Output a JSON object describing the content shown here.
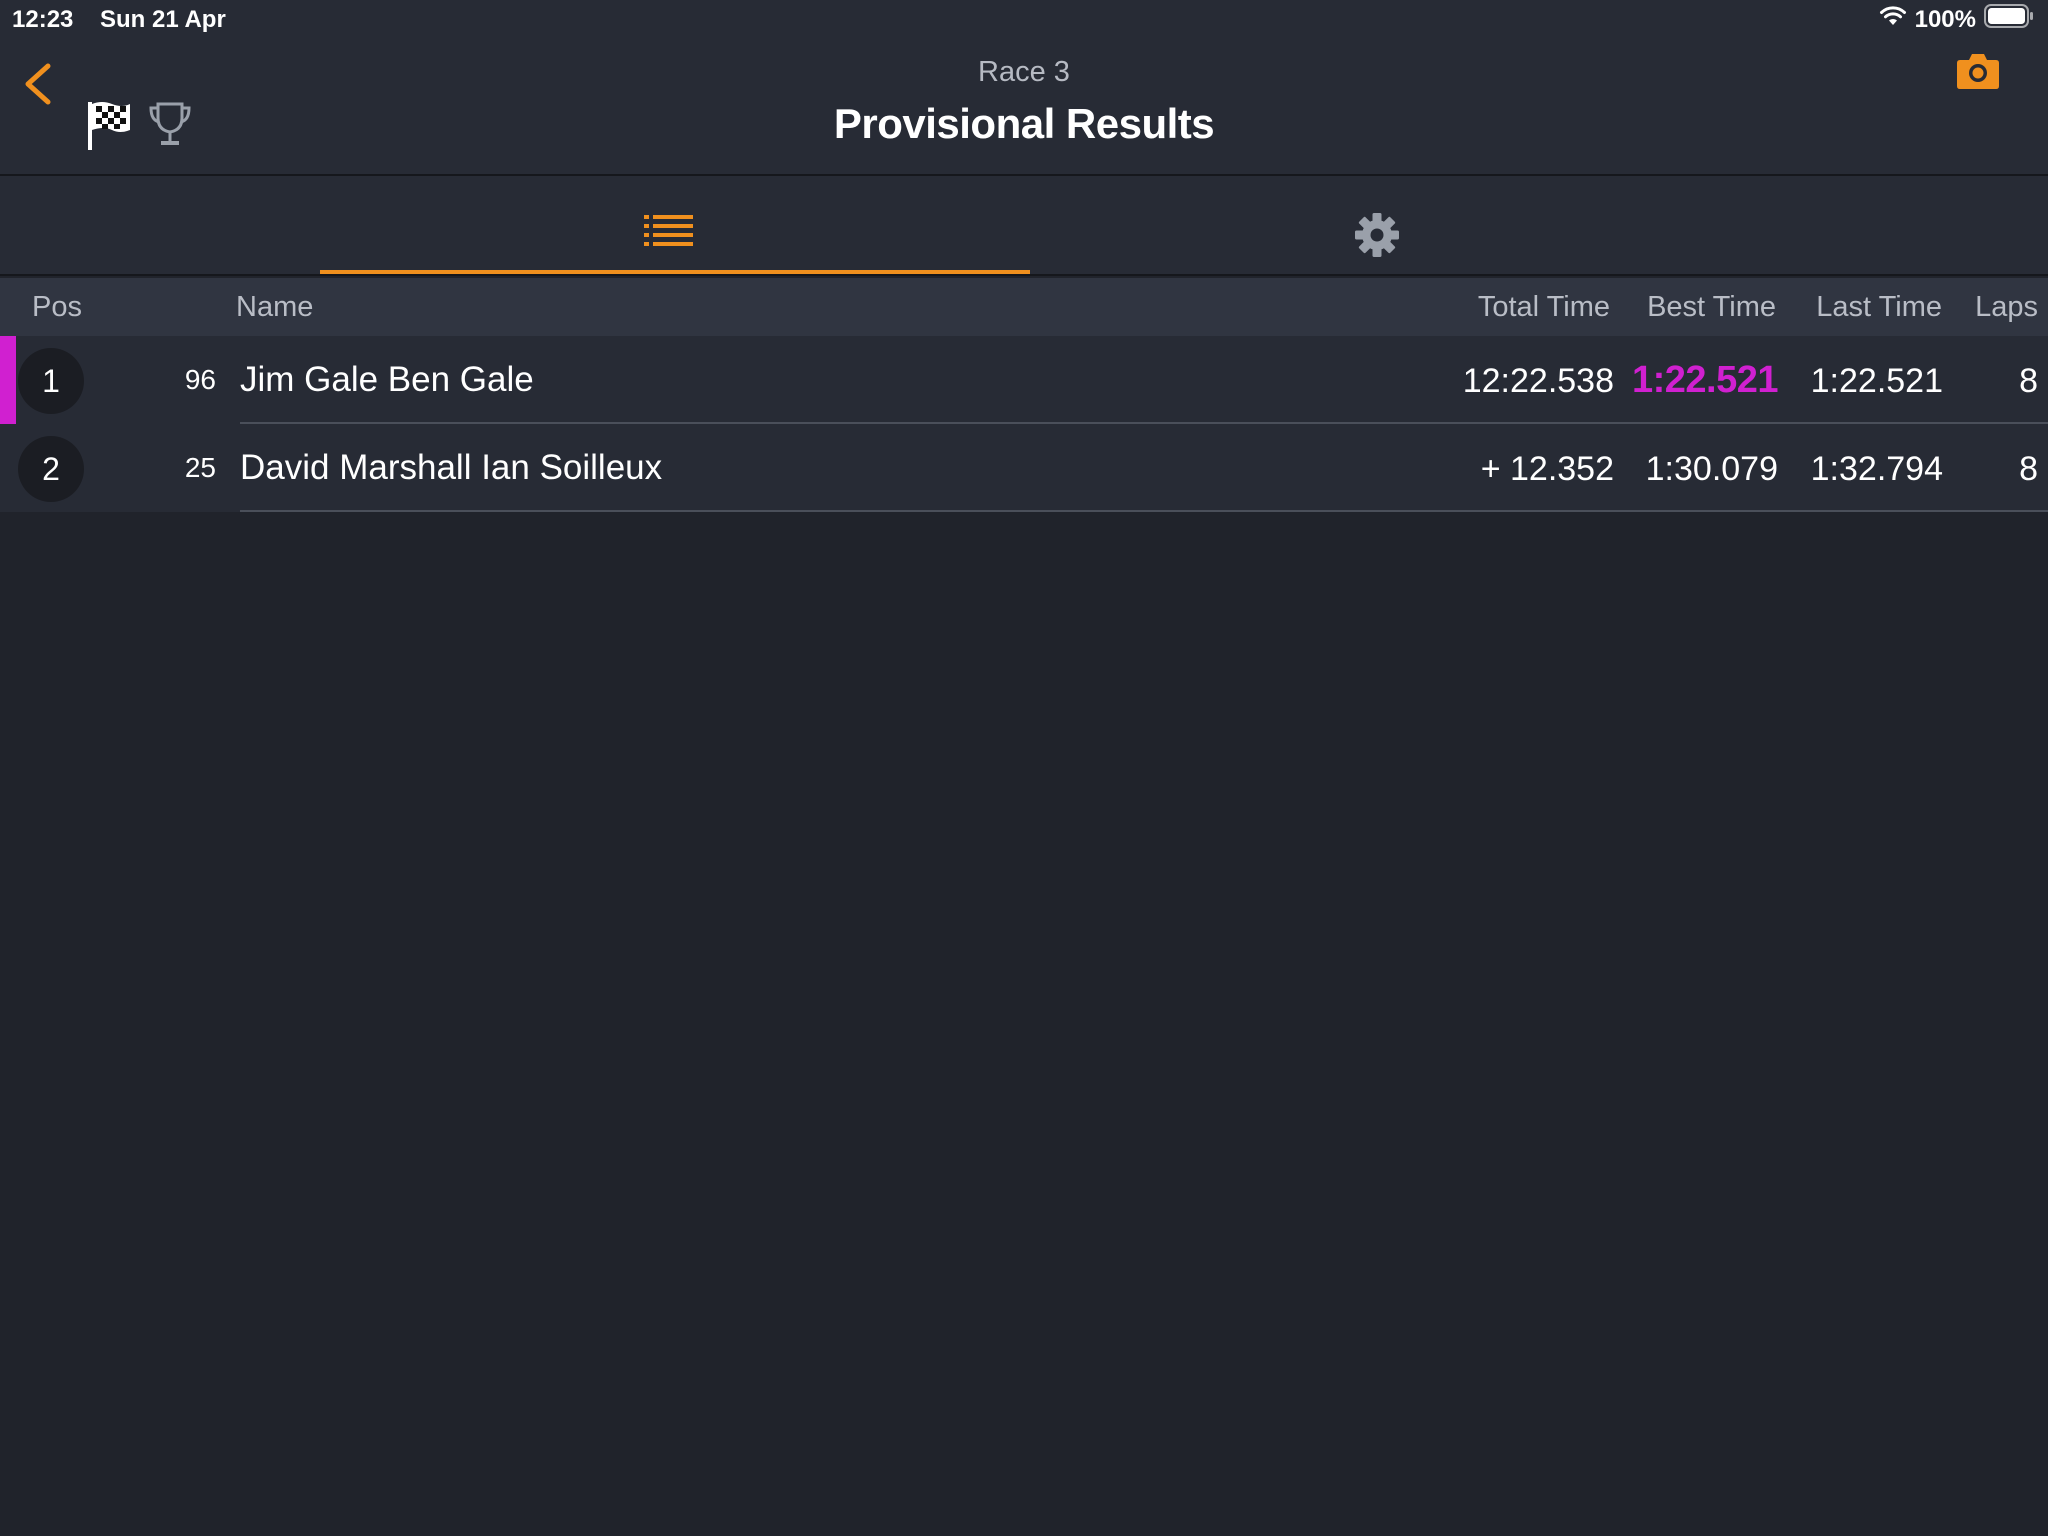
{
  "status_bar": {
    "time": "12:23",
    "date": "Sun 21 Apr",
    "battery": "100%"
  },
  "header": {
    "subtitle": "Race 3",
    "title": "Provisional Results"
  },
  "tabs": [
    {
      "name": "list",
      "icon": "list-icon",
      "selected": true
    },
    {
      "name": "settings",
      "icon": "gear-icon",
      "selected": false
    }
  ],
  "table": {
    "columns": {
      "pos": "Pos",
      "name": "Name",
      "total_time": "Total Time",
      "best_time": "Best Time",
      "last_time": "Last Time",
      "laps": "Laps"
    },
    "rows": [
      {
        "pos": "1",
        "number": "96",
        "name": "Jim Gale Ben Gale",
        "total_time": "12:22.538",
        "best_time": "1:22.521",
        "last_time": "1:22.521",
        "laps": "8",
        "fastest_lap": true
      },
      {
        "pos": "2",
        "number": "25",
        "name": "David Marshall Ian Soilleux",
        "total_time": "+ 12.352",
        "best_time": "1:30.079",
        "last_time": "1:32.794",
        "laps": "8",
        "fastest_lap": false
      }
    ]
  },
  "colors": {
    "accent": "#f0901e",
    "fastest": "#d020d0",
    "background": "#20232b",
    "panel": "#272b35"
  }
}
